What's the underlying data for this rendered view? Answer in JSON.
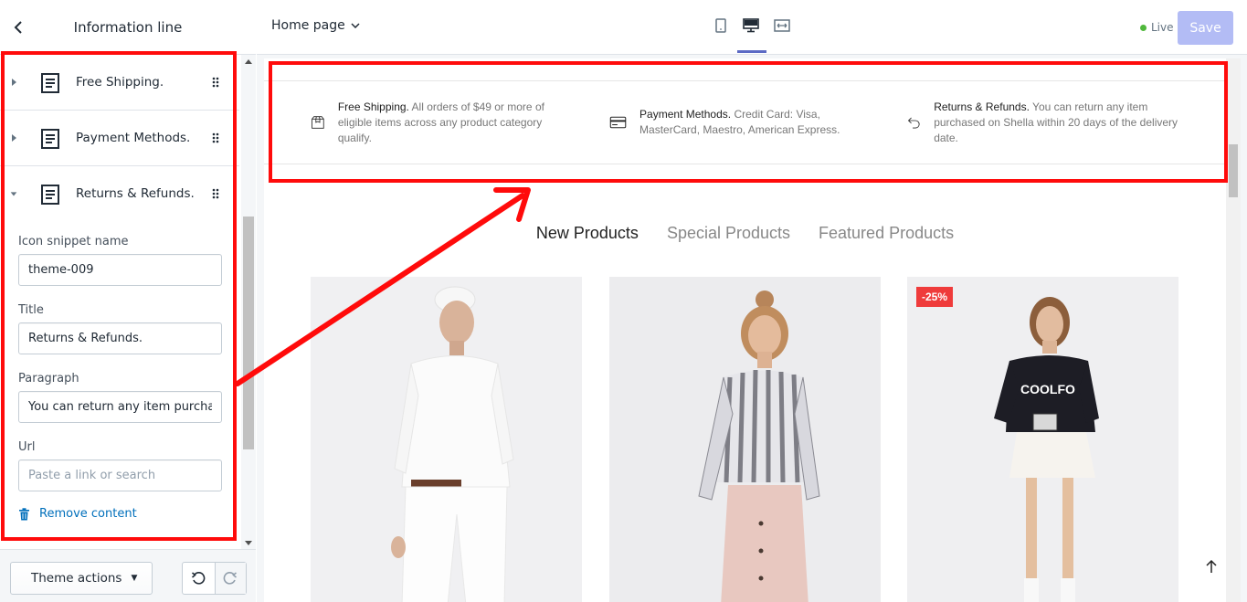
{
  "sidebar": {
    "title": "Information line",
    "blocks": [
      {
        "label": "Free Shipping.",
        "expanded": false
      },
      {
        "label": "Payment Methods.",
        "expanded": false
      },
      {
        "label": "Returns & Refunds.",
        "expanded": true
      }
    ],
    "form": {
      "icon_label": "Icon snippet name",
      "icon_value": "theme-009",
      "title_label": "Title",
      "title_value": "Returns & Refunds.",
      "paragraph_label": "Paragraph",
      "paragraph_value": "You can return any item purchased on Shella within 20 days of the delivery date.",
      "url_label": "Url",
      "url_placeholder": "Paste a link or search",
      "remove_label": "Remove content"
    },
    "footer": {
      "theme_actions_label": "Theme actions"
    }
  },
  "topbar": {
    "page_select": "Home page",
    "live_label": "Live",
    "save_label": "Save",
    "colors": {
      "accent": "#5c6ac4",
      "save_disabled": "#b3bcf5",
      "live": "#50b83c"
    }
  },
  "preview": {
    "info_items": [
      {
        "title": "Free Shipping.",
        "text": "All orders of $49 or more of eligible items across any product category qualify."
      },
      {
        "title": "Payment Methods.",
        "text": "Credit Card: Visa, MasterCard, Maestro, American Express."
      },
      {
        "title": "Returns & Refunds.",
        "text": "You can return any item purchased on Shella within 20 days of the delivery date."
      }
    ],
    "tabs": [
      "New Products",
      "Special Products",
      "Featured Products"
    ],
    "badge": "-25%"
  },
  "annotation": {
    "color": "#ff0b0b"
  }
}
